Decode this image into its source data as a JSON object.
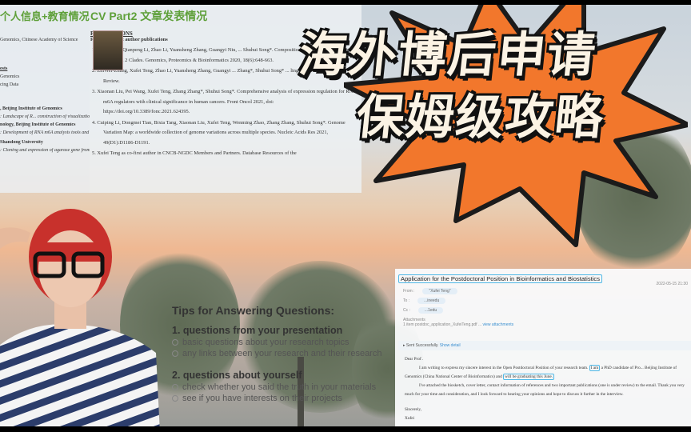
{
  "cv_left": {
    "heading": "个人信息+教育情况",
    "lines": [
      "Genomics, Chinese Academy of Science",
      "ests",
      "Genomics",
      "cing Data",
      ", Beijing Institute of Genomics",
      ": Landscape of R... construction of visualization platform",
      "nology, Beijing Institute of Genomics",
      ": Development of RNA m6A analysis tools and",
      "Shandong University",
      ": Cloning and expression of agarase gene from"
    ]
  },
  "cv_main": {
    "heading": "CV Part2 文章发表情况",
    "section": "PUBLICATIONS",
    "subsection": "First or co-first author publications",
    "pubs": [
      "1. Xufei Teng, Qianpeng Li, Zhao Li, Yuansheng Zhang, Guangyi Niu, ... Shuhui Song*. Compositional Variability and Mutation Spectra ... 2 Clades. Genomics, Proteomics & Bioinformatics 2020, 18(6):648-663.",
      "2. ZhiWei-Zhang, Xufei Teng, Zhao Li, Yuansheng Zhang, Guangyi ... Zhang*, Shuhui Song* ... ling. Cell Reports, Under Review.",
      "3. Xiaonan Liu, Pei Wang, Xufei Teng, Zhang Zhang*, Shuhui Song*. Comprehensive analysis of expression regulation for RNA m6A regulators with clinical significance in human cancers. Front Oncol 2021, doi: https://doi.org/10.3389/fonc.2021.624395.",
      "4. Cuiping Li, Dongmei Tian, Bixia Tang, Xiaonan Liu, Xufei Teng, Wenming Zhao, Zhang Zhang, Shuhui Song*. Genome Variation Map: a worldwide collection of genome variations across multiple species. Nucleic Acids Res 2021, 49(D1):D1186-D1191.",
      "5. Xufei Teng as co-first author in CNCB-NGDC Members and Partners. Database Resources of the"
    ]
  },
  "headline": {
    "line1": "海外博后申请",
    "line2": "保姆级攻略"
  },
  "tips": {
    "title": "Tips for Answering Questions:",
    "groups": [
      {
        "heading": "1. questions from your presentation",
        "items": [
          "basic questions about your research topics",
          "any links between your research and their research"
        ]
      },
      {
        "heading": "2. questions about yourself",
        "items": [
          "check whether you said the truth in your materials",
          "see if you have interests on their projects"
        ]
      }
    ]
  },
  "email": {
    "subject": "Application for the Postdoctoral Position in Bioinformatics and Biostatistics",
    "date": "2022-05-15 21:30",
    "from_label": "From :",
    "from_value": "\"Xufei Teng\"",
    "to_label": "To :",
    "to_value": "...ineedu",
    "cc_label": "Cc :",
    "cc_value": "...1edu",
    "attachments_label": "Attachments",
    "attachment": "1 item postdoc_application_XufeiTeng.pdf ...",
    "view_attachments": "view attachments",
    "sent_status": "Sent Successfully.",
    "show_detail": "Show detail",
    "greeting": "Dear Prof .",
    "p1a": "I am writing to express my sincere interest in the Open Postdoctoral Position of your research team.",
    "p1b": "I am",
    "p1c": "a PhD candidate of Pro... Beijing Institute of Genomics (China National Center of Bioinformatics) and",
    "p1d": "will be graduating this June.",
    "p2": "I've attached the biosketch, cover letter, contact information of references and two important publications (one is under review) to the email. Thank you very much for your time and consideration, and I look forward to hearing your opinions and hope to discuss it further in the interview.",
    "closing": "Sincerely,",
    "signature": "Xufei"
  },
  "colors": {
    "accent_green": "#5fa03a",
    "star_orange": "#f2772c",
    "highlight_blue": "#4fb8e6"
  }
}
